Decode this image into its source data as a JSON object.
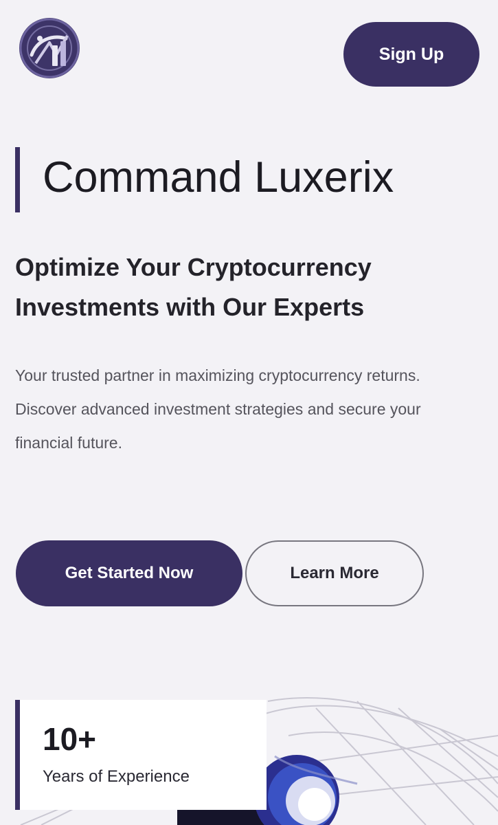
{
  "header": {
    "logo_icon": "crypto-logo-icon",
    "signup_label": "Sign Up"
  },
  "hero": {
    "title": "Command Luxerix",
    "subtitle": "Optimize Your Cryptocurrency Investments with Our Experts",
    "description": "Your trusted partner in maximizing cryptocurrency returns. Discover advanced investment strategies and secure your financial future.",
    "primary_cta": "Get Started Now",
    "secondary_cta": "Learn More"
  },
  "stats": {
    "value": "10+",
    "label": "Years of Experience"
  },
  "colors": {
    "accent": "#3a3063",
    "background": "#f3f2f6",
    "text": "#1c1b22"
  }
}
